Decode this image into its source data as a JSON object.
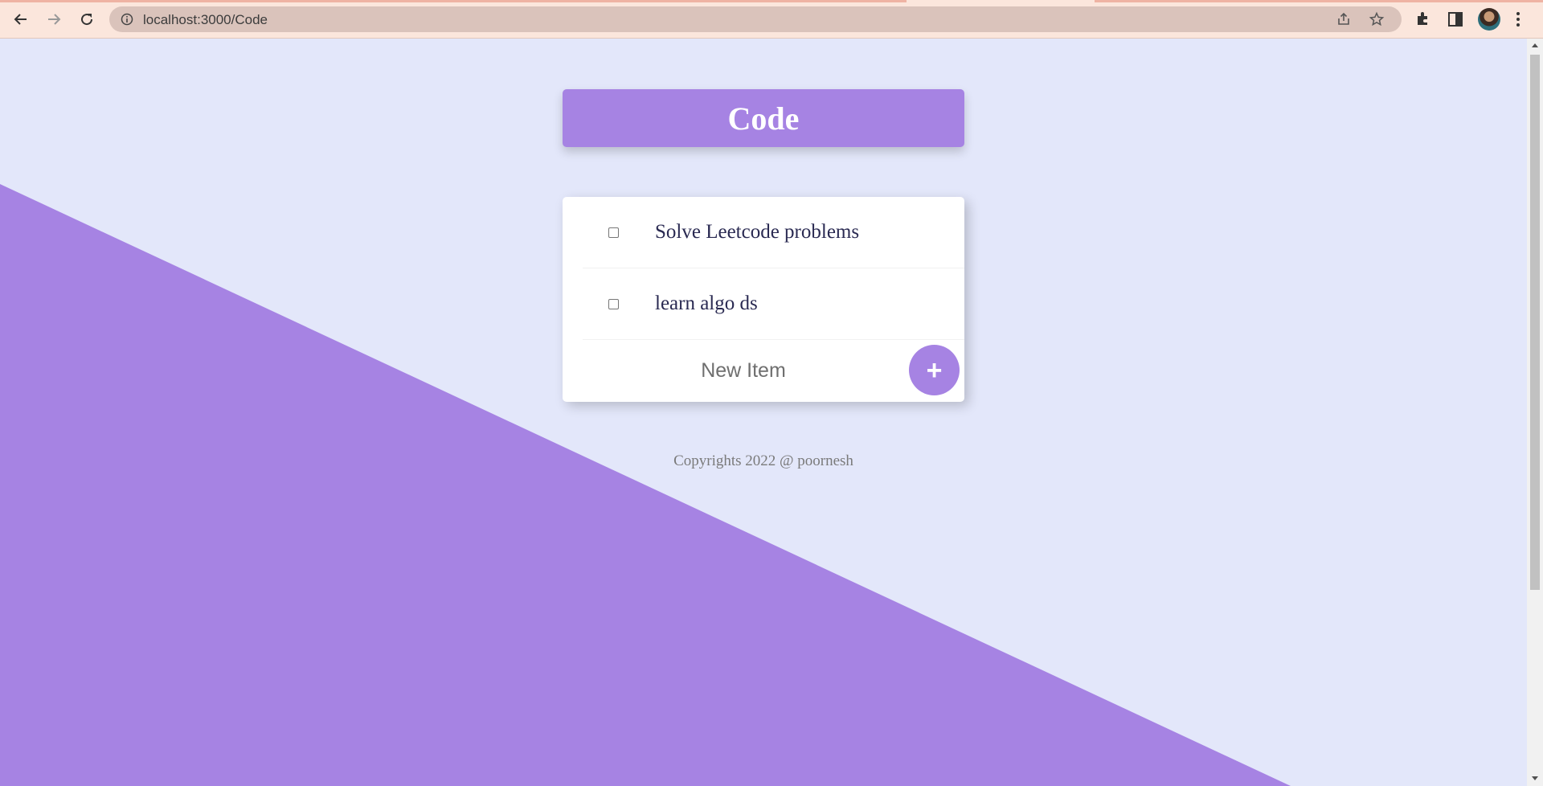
{
  "browser": {
    "url": "localhost:3000/Code"
  },
  "app": {
    "title": "Code",
    "items": [
      {
        "label": "Solve Leetcode problems",
        "checked": false
      },
      {
        "label": "learn algo ds",
        "checked": false
      }
    ],
    "new_item_placeholder": "New Item",
    "add_button_label": "+",
    "footer": "Copyrights 2022 @ poornesh"
  },
  "colors": {
    "accent": "#a683e3",
    "background": "#e3e7fa"
  }
}
